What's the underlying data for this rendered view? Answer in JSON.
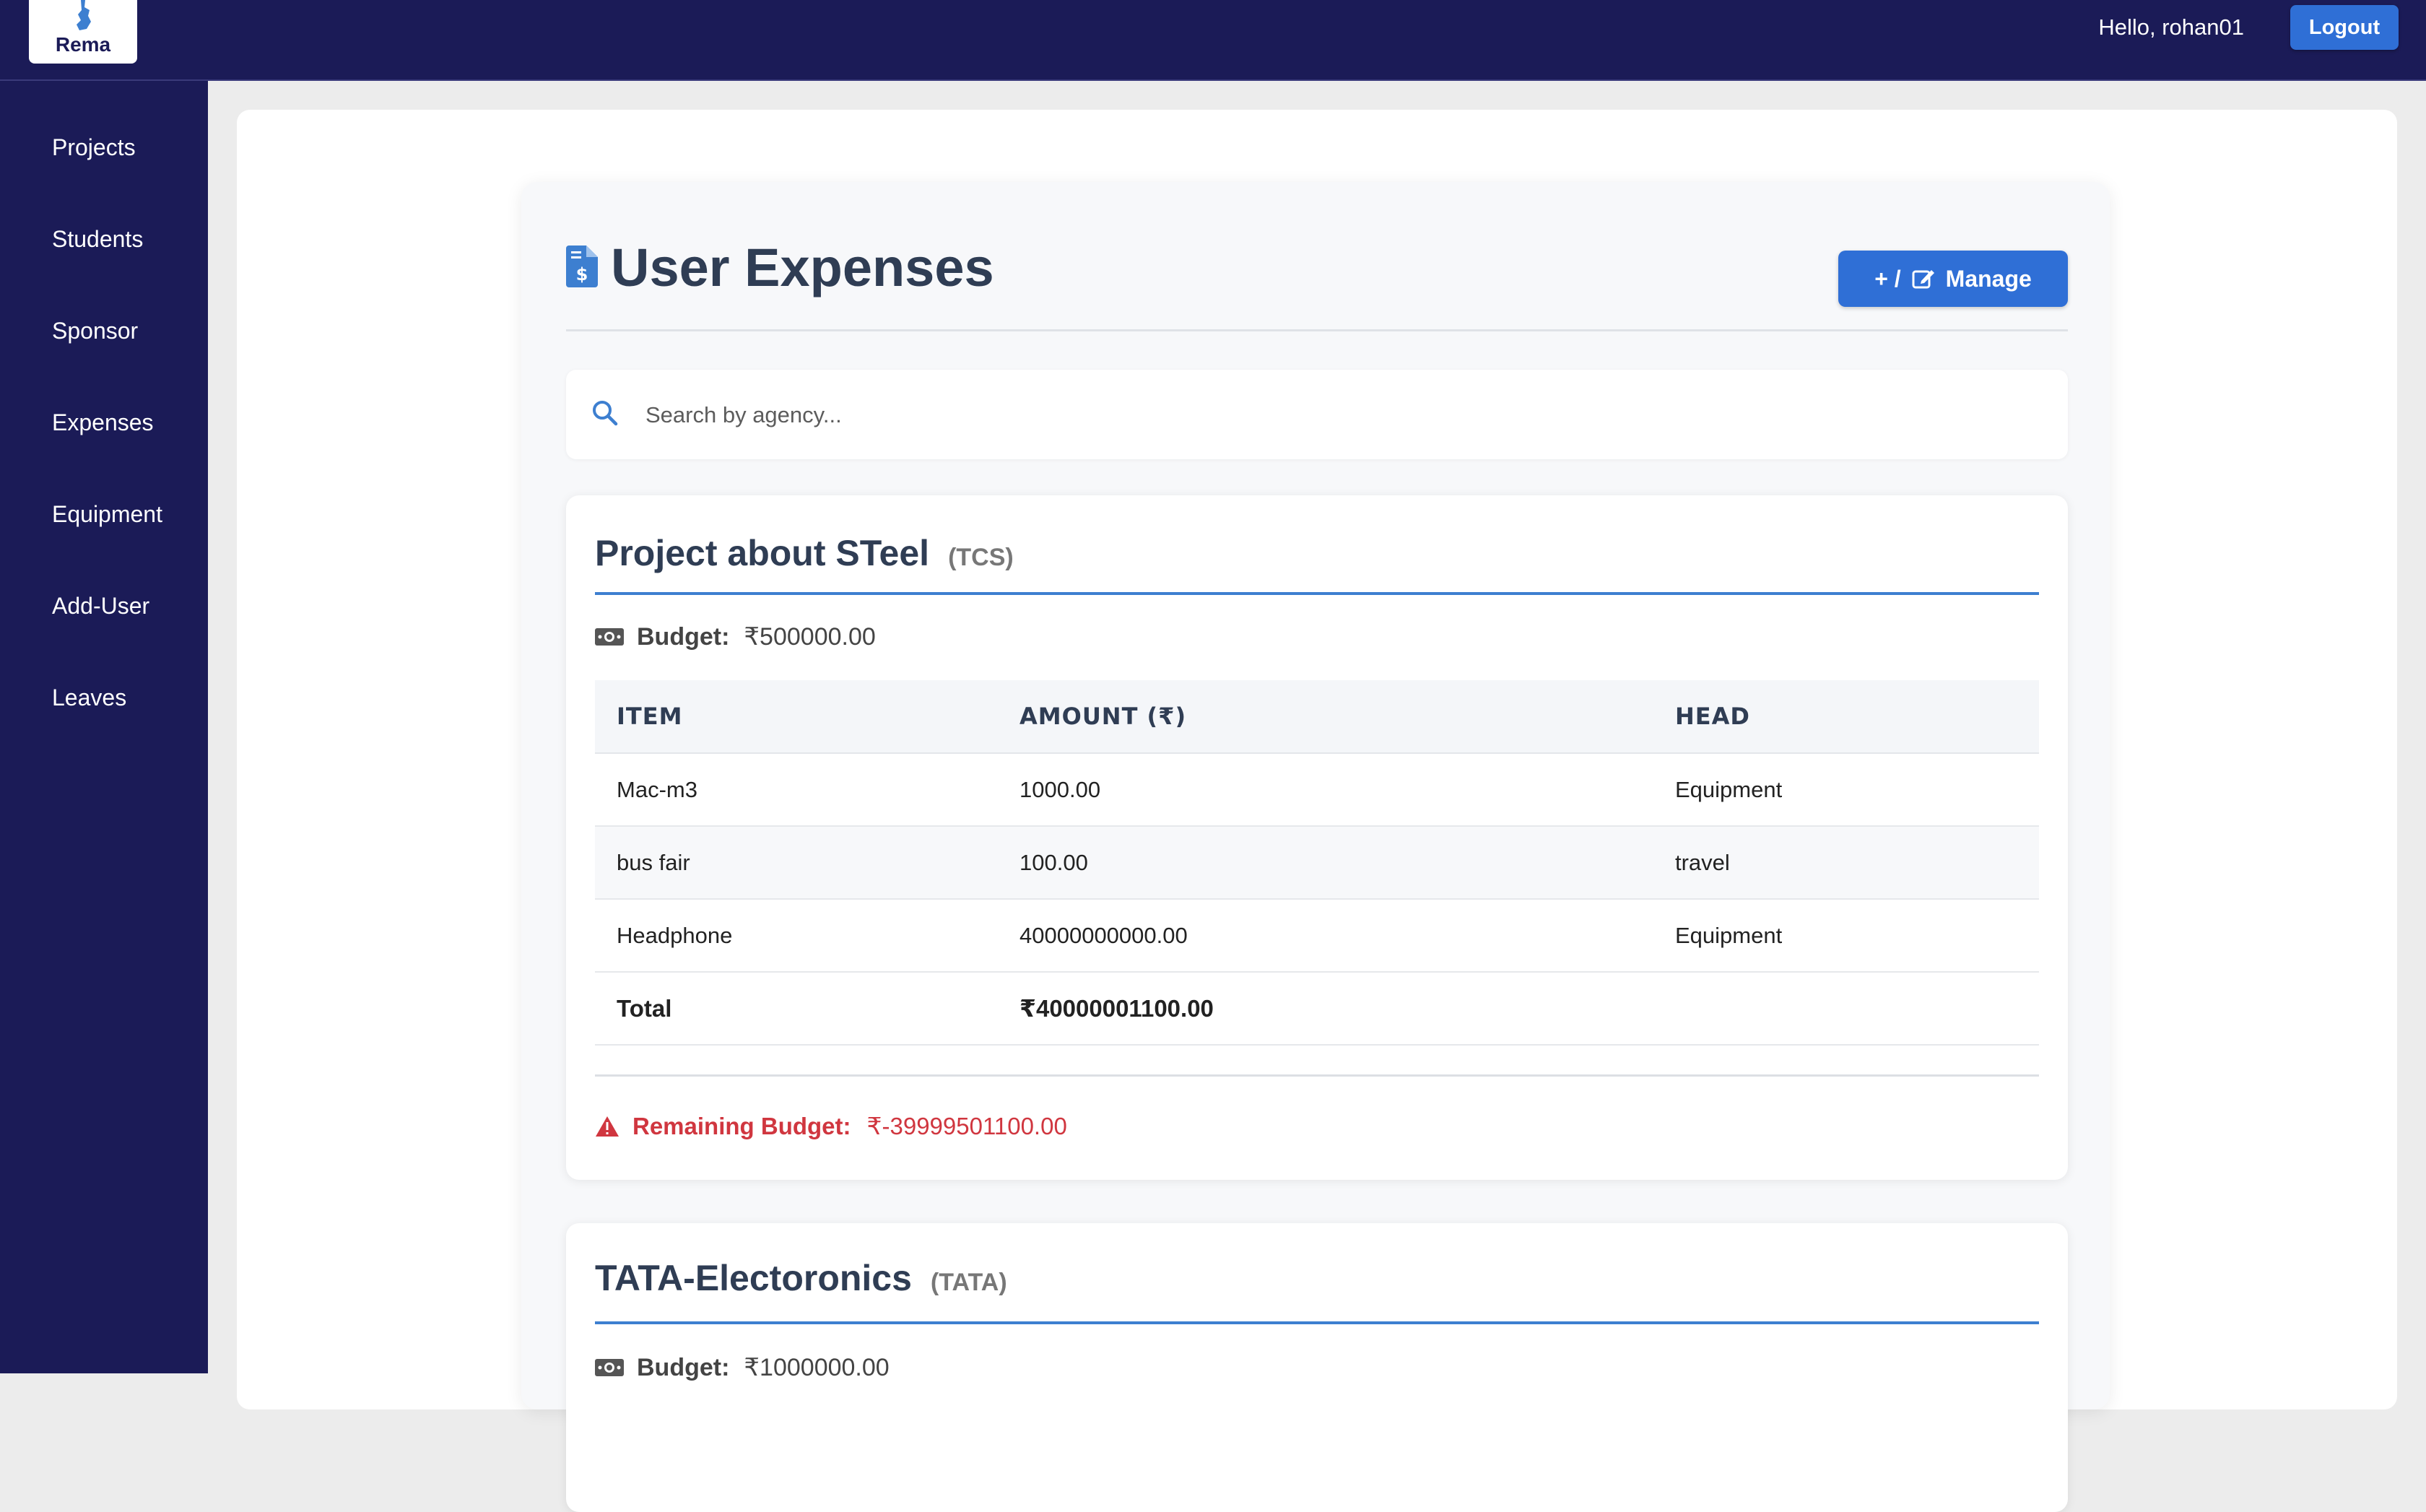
{
  "header": {
    "logo_text": "Rema",
    "greeting": "Hello, rohan01",
    "logout_label": "Logout"
  },
  "sidebar": {
    "items": [
      {
        "label": "Projects"
      },
      {
        "label": "Students"
      },
      {
        "label": "Sponsor"
      },
      {
        "label": "Expenses"
      },
      {
        "label": "Equipment"
      },
      {
        "label": "Add-User"
      },
      {
        "label": "Leaves"
      }
    ]
  },
  "page": {
    "title": "User Expenses",
    "manage_label": "Manage",
    "manage_prefix": "+ /",
    "search_placeholder": "Search by agency..."
  },
  "table_headers": {
    "item": "ITEM",
    "amount": "AMOUNT (₹)",
    "head": "HEAD"
  },
  "labels": {
    "budget": "Budget:",
    "total": "Total",
    "remaining": "Remaining Budget:"
  },
  "projects": [
    {
      "name": "Project about STeel",
      "code": "(TCS)",
      "budget": "₹500000.00",
      "rows": [
        {
          "item": "Mac-m3",
          "amount": "1000.00",
          "head": "Equipment"
        },
        {
          "item": "bus fair",
          "amount": "100.00",
          "head": "travel"
        },
        {
          "item": "Headphone",
          "amount": "40000000000.00",
          "head": "Equipment"
        }
      ],
      "total": "₹40000001100.00",
      "remaining": "₹-39999501100.00"
    },
    {
      "name": "TATA-Electoronics",
      "code": "(TATA)",
      "budget": "₹1000000.00"
    }
  ],
  "colors": {
    "navy": "#1b1b57",
    "accent_blue": "#2f6fd6",
    "rule_blue": "#3d7fd0",
    "warning_red": "#d0363f"
  },
  "icons": {
    "title": "file-invoice-dollar-icon",
    "search": "search-icon",
    "budget": "money-bill-icon",
    "warning": "warning-triangle-icon",
    "manage": "edit-icon"
  }
}
